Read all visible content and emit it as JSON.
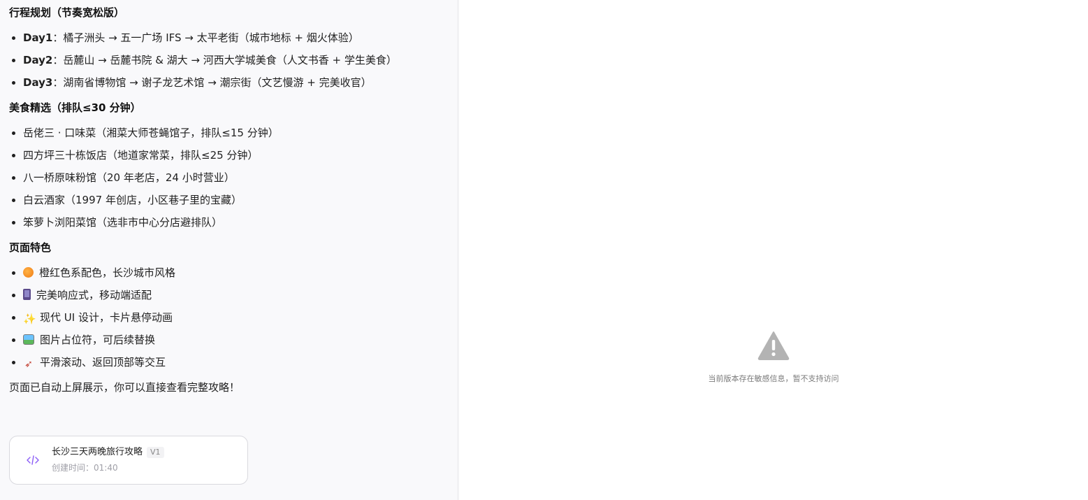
{
  "sections": {
    "itinerary_title": "行程规划（节奏宽松版）",
    "itinerary": [
      {
        "day": "Day1",
        "text": "：橘子洲头 → 五一广场 IFS → 太平老街（城市地标 + 烟火体验）"
      },
      {
        "day": "Day2",
        "text": "：岳麓山 → 岳麓书院 & 湖大 → 河西大学城美食（人文书香 + 学生美食）"
      },
      {
        "day": "Day3",
        "text": "：湖南省博物馆 → 谢子龙艺术馆 → 潮宗街（文艺慢游 + 完美收官）"
      }
    ],
    "food_title": "美食精选（排队≤30 分钟）",
    "food": [
      "岳佬三 · 口味菜（湘菜大师苍蝇馆子，排队≤15 分钟）",
      "四方坪三十栋饭店（地道家常菜，排队≤25 分钟）",
      "八一桥原味粉馆（20 年老店，24 小时营业）",
      "白云酒家（1997 年创店，小区巷子里的宝藏）",
      "笨萝卜浏阳菜馆（选非市中心分店避排队）"
    ],
    "features_title": "页面特色",
    "features": [
      {
        "icon": "orange-icon",
        "text": "橙红色系配色，长沙城市风格"
      },
      {
        "icon": "mobile-phone-icon",
        "text": "完美响应式，移动端适配"
      },
      {
        "icon": "sparkles-icon",
        "text": "现代 UI 设计，卡片悬停动画"
      },
      {
        "icon": "picture-icon",
        "text": "图片占位符，可后续替换"
      },
      {
        "icon": "rocket-icon",
        "text": "平滑滚动、返回顶部等交互"
      }
    ],
    "closing": "页面已自动上屏展示，你可以直接查看完整攻略！"
  },
  "card": {
    "title": "长沙三天两晚旅行攻略",
    "version": "V1",
    "created": "创建时间：01:40",
    "icon": "code-icon"
  },
  "preview": {
    "icon": "warning-icon",
    "message": "当前版本存在敏感信息，暂不支持访问",
    "icon_color": "#b3b3b3"
  }
}
